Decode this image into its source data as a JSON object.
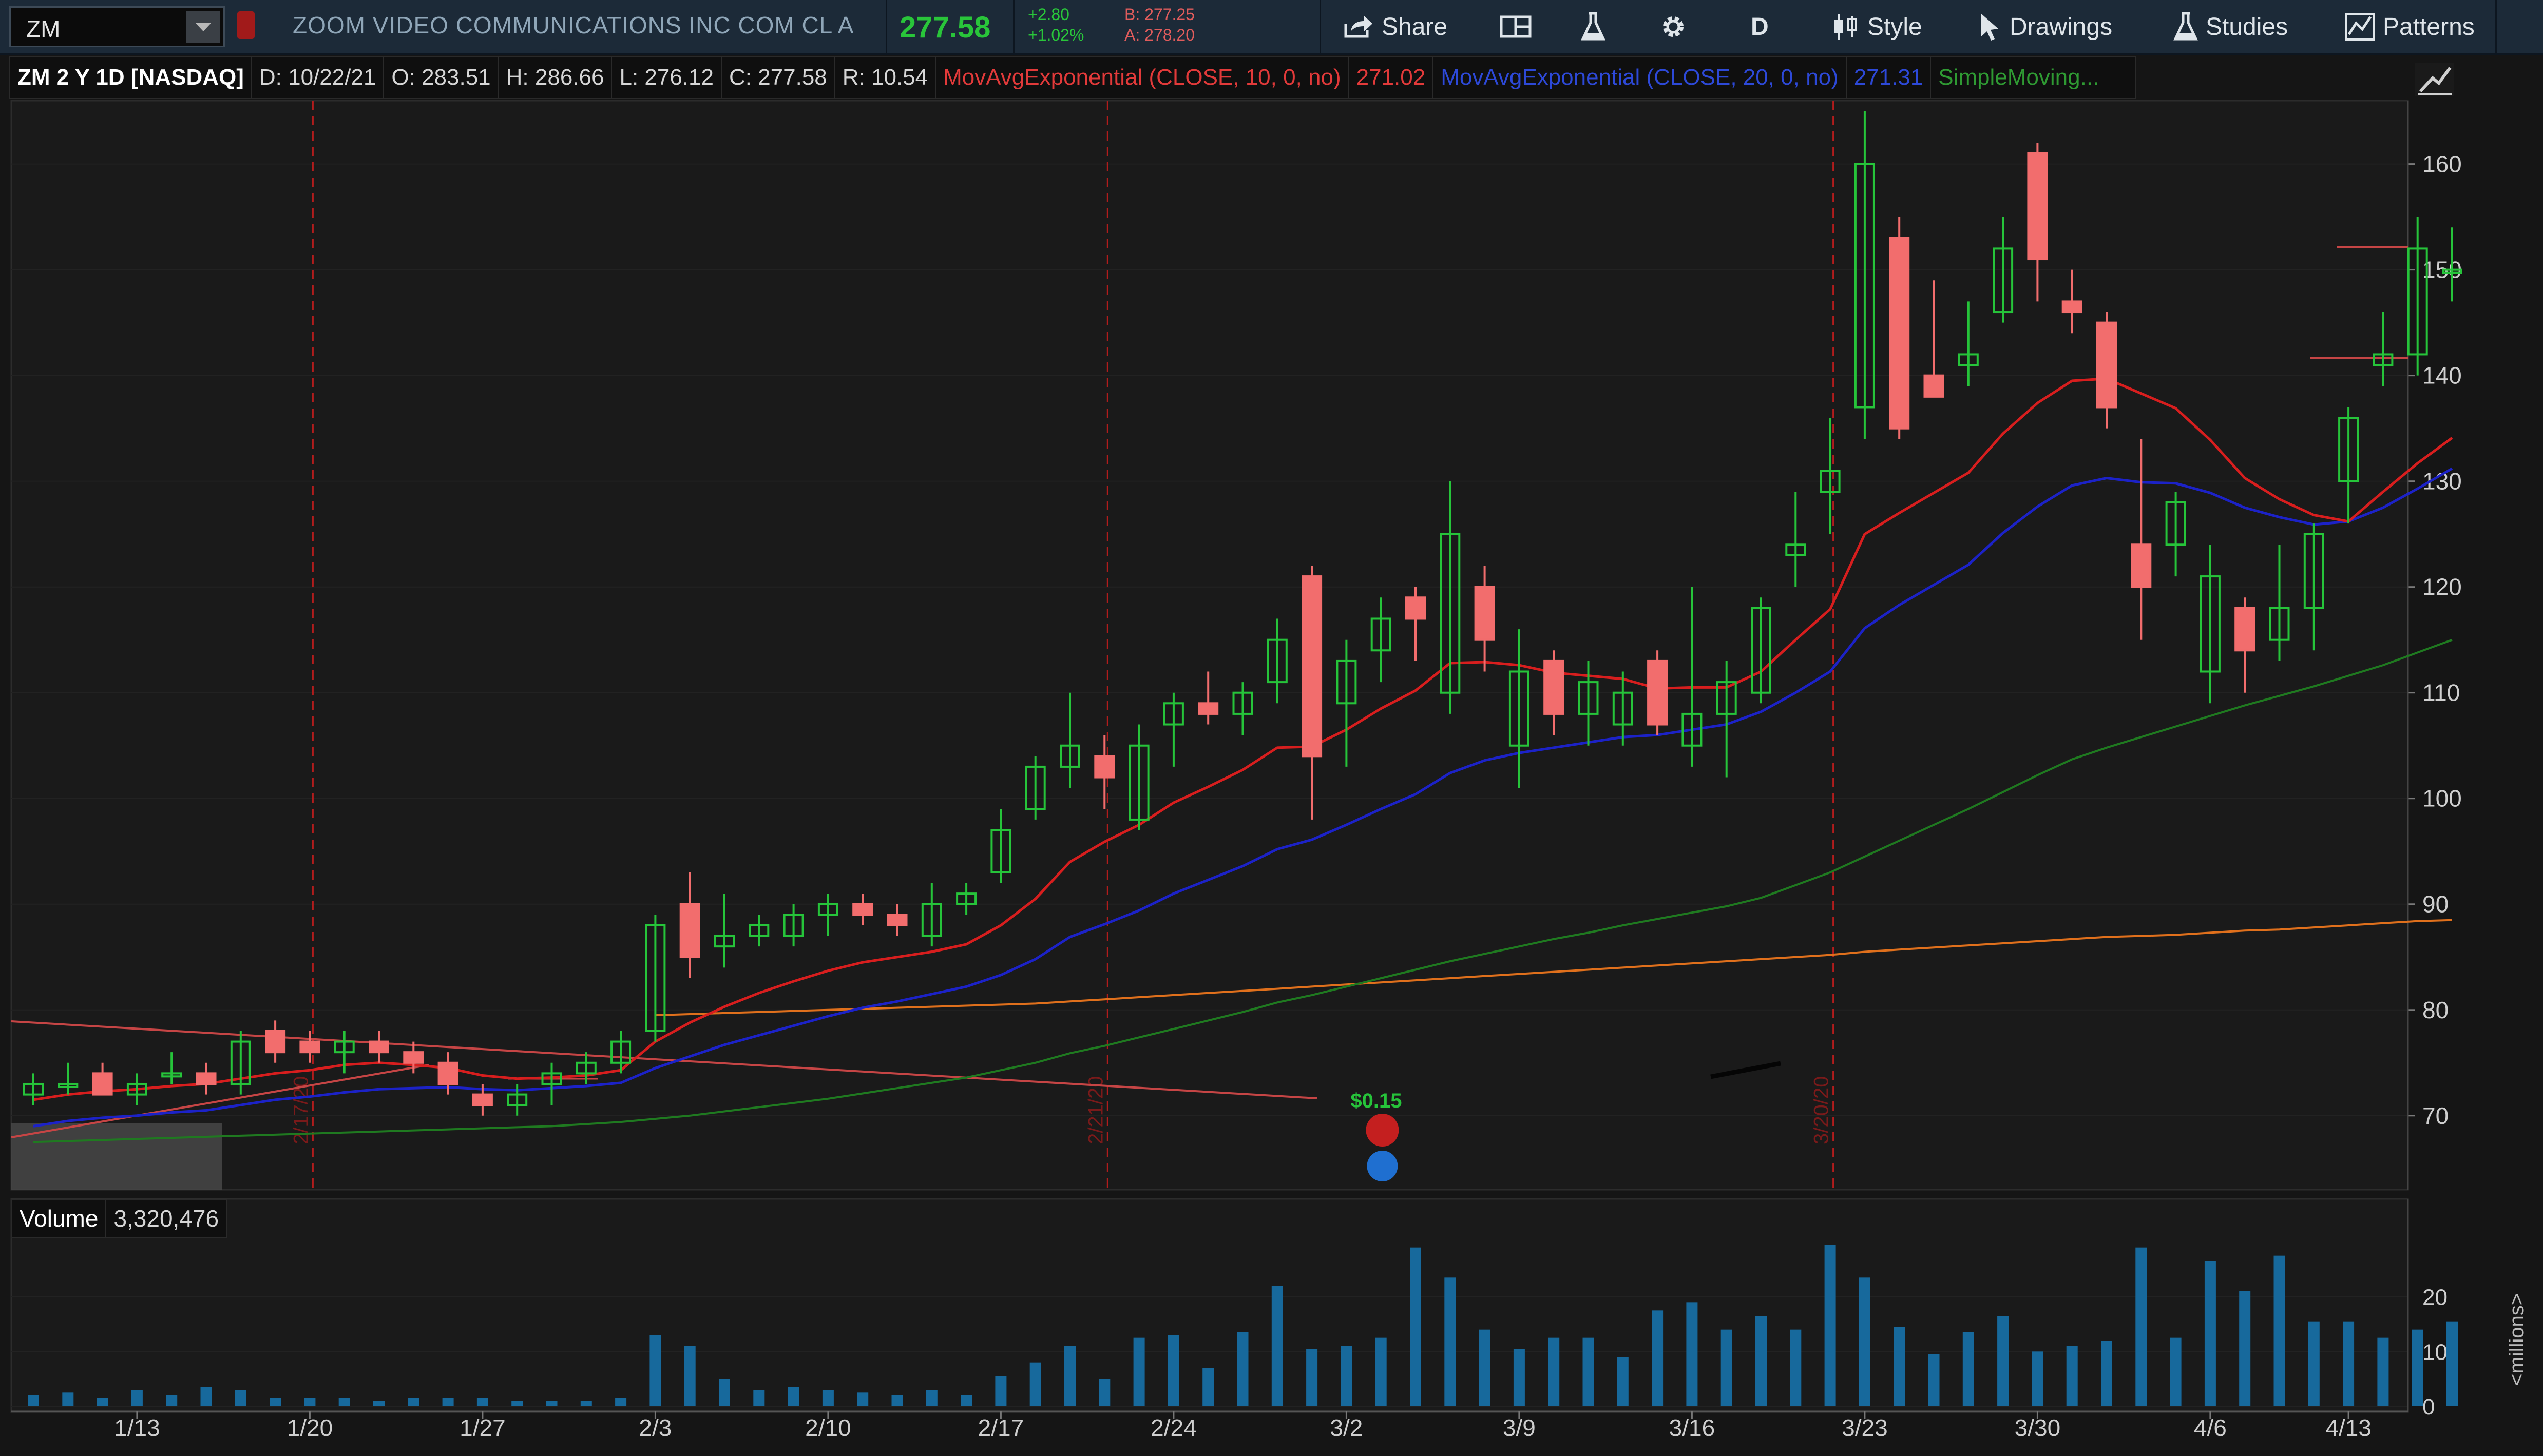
{
  "header": {
    "symbol": "ZM",
    "company": "ZOOM VIDEO COMMUNICATIONS INC COM CL A",
    "last": "277.58",
    "change": "+2.80",
    "change_pct": "+1.02%",
    "bid": "B: 277.25",
    "ask": "A: 278.20",
    "buttons": {
      "share": "Share",
      "period": "D",
      "style": "Style",
      "drawings": "Drawings",
      "studies": "Studies",
      "patterns": "Patterns"
    }
  },
  "info_bar": {
    "title": "ZM 2 Y 1D [NASDAQ]",
    "date": "D: 10/22/21",
    "open": "O: 283.51",
    "high": "H: 286.66",
    "low": "L: 276.12",
    "close": "C: 277.58",
    "range": "R: 10.54",
    "ema10_label": "MovAvgExponential (CLOSE, 10, 0, no)",
    "ema10_value": "271.02",
    "ema20_label": "MovAvgExponential (CLOSE, 20, 0, no)",
    "ema20_value": "271.31",
    "sma_label": "SimpleMoving..."
  },
  "volume_panel": {
    "label": "Volume",
    "value": "3,320,476",
    "unit_label": "<millions>"
  },
  "colors": {
    "up": "#26c43a",
    "down": "#f26d6d",
    "ema10": "#d81e1e",
    "ema20": "#1c22c8",
    "sma_green": "#1f7a20",
    "sma_orange": "#e0701c",
    "volume": "#17699c",
    "marker": "#c41f1f"
  },
  "chart_data": {
    "type": "candlestick",
    "title": "ZM 2 Y 1D [NASDAQ]",
    "ylim": [
      63,
      166
    ],
    "y_ticks": [
      70,
      80,
      90,
      100,
      110,
      120,
      130,
      140,
      150,
      160
    ],
    "x_tick_labels": [
      "1/13",
      "1/20",
      "1/27",
      "2/3",
      "2/10",
      "2/17",
      "2/24",
      "3/2",
      "3/9",
      "3/16",
      "3/23",
      "3/30",
      "4/6",
      "4/13"
    ],
    "x_tick_index": [
      3,
      8,
      13,
      18,
      23,
      28,
      33,
      38,
      43,
      48,
      53,
      58,
      63,
      67
    ],
    "candles": [
      {
        "o": 72,
        "h": 74,
        "l": 71,
        "c": 73
      },
      {
        "o": 73,
        "h": 75,
        "l": 72,
        "c": 73
      },
      {
        "o": 74,
        "h": 75,
        "l": 72,
        "c": 72
      },
      {
        "o": 72,
        "h": 74,
        "l": 71,
        "c": 73
      },
      {
        "o": 74,
        "h": 76,
        "l": 73,
        "c": 74
      },
      {
        "o": 74,
        "h": 75,
        "l": 72,
        "c": 73
      },
      {
        "o": 73,
        "h": 78,
        "l": 72,
        "c": 77
      },
      {
        "o": 78,
        "h": 79,
        "l": 75,
        "c": 76
      },
      {
        "o": 77,
        "h": 78,
        "l": 75,
        "c": 76
      },
      {
        "o": 76,
        "h": 78,
        "l": 74,
        "c": 77
      },
      {
        "o": 77,
        "h": 78,
        "l": 75,
        "c": 76
      },
      {
        "o": 76,
        "h": 77,
        "l": 74,
        "c": 75
      },
      {
        "o": 75,
        "h": 76,
        "l": 72,
        "c": 73
      },
      {
        "o": 72,
        "h": 73,
        "l": 70,
        "c": 71
      },
      {
        "o": 71,
        "h": 73,
        "l": 70,
        "c": 72
      },
      {
        "o": 73,
        "h": 75,
        "l": 71,
        "c": 74
      },
      {
        "o": 74,
        "h": 76,
        "l": 73,
        "c": 75
      },
      {
        "o": 75,
        "h": 78,
        "l": 74,
        "c": 77
      },
      {
        "o": 78,
        "h": 89,
        "l": 77,
        "c": 88
      },
      {
        "o": 90,
        "h": 93,
        "l": 83,
        "c": 85
      },
      {
        "o": 86,
        "h": 91,
        "l": 84,
        "c": 87
      },
      {
        "o": 87,
        "h": 89,
        "l": 86,
        "c": 88
      },
      {
        "o": 87,
        "h": 90,
        "l": 86,
        "c": 89
      },
      {
        "o": 89,
        "h": 91,
        "l": 87,
        "c": 90
      },
      {
        "o": 90,
        "h": 91,
        "l": 88,
        "c": 89
      },
      {
        "o": 89,
        "h": 90,
        "l": 87,
        "c": 88
      },
      {
        "o": 87,
        "h": 92,
        "l": 86,
        "c": 90
      },
      {
        "o": 90,
        "h": 92,
        "l": 89,
        "c": 91
      },
      {
        "o": 93,
        "h": 99,
        "l": 92,
        "c": 97
      },
      {
        "o": 99,
        "h": 104,
        "l": 98,
        "c": 103
      },
      {
        "o": 103,
        "h": 110,
        "l": 101,
        "c": 105
      },
      {
        "o": 104,
        "h": 106,
        "l": 99,
        "c": 102
      },
      {
        "o": 98,
        "h": 107,
        "l": 97,
        "c": 105
      },
      {
        "o": 107,
        "h": 110,
        "l": 103,
        "c": 109
      },
      {
        "o": 109,
        "h": 112,
        "l": 107,
        "c": 108
      },
      {
        "o": 108,
        "h": 111,
        "l": 106,
        "c": 110
      },
      {
        "o": 111,
        "h": 117,
        "l": 109,
        "c": 115
      },
      {
        "o": 121,
        "h": 122,
        "l": 98,
        "c": 104
      },
      {
        "o": 109,
        "h": 115,
        "l": 103,
        "c": 113
      },
      {
        "o": 114,
        "h": 119,
        "l": 111,
        "c": 117
      },
      {
        "o": 119,
        "h": 120,
        "l": 113,
        "c": 117
      },
      {
        "o": 110,
        "h": 130,
        "l": 108,
        "c": 125
      },
      {
        "o": 120,
        "h": 122,
        "l": 112,
        "c": 115
      },
      {
        "o": 105,
        "h": 116,
        "l": 101,
        "c": 112
      },
      {
        "o": 113,
        "h": 114,
        "l": 106,
        "c": 108
      },
      {
        "o": 108,
        "h": 113,
        "l": 105,
        "c": 111
      },
      {
        "o": 107,
        "h": 112,
        "l": 105,
        "c": 110
      },
      {
        "o": 113,
        "h": 114,
        "l": 106,
        "c": 107
      },
      {
        "o": 105,
        "h": 120,
        "l": 103,
        "c": 108
      },
      {
        "o": 108,
        "h": 113,
        "l": 102,
        "c": 111
      },
      {
        "o": 110,
        "h": 119,
        "l": 109,
        "c": 118
      },
      {
        "o": 123,
        "h": 129,
        "l": 120,
        "c": 124
      },
      {
        "o": 129,
        "h": 136,
        "l": 125,
        "c": 131
      },
      {
        "o": 137,
        "h": 165,
        "l": 134,
        "c": 160
      },
      {
        "o": 153,
        "h": 155,
        "l": 134,
        "c": 135
      },
      {
        "o": 140,
        "h": 149,
        "l": 138,
        "c": 138
      },
      {
        "o": 141,
        "h": 147,
        "l": 139,
        "c": 142
      },
      {
        "o": 146,
        "h": 155,
        "l": 145,
        "c": 152
      },
      {
        "o": 161,
        "h": 162,
        "l": 147,
        "c": 151
      },
      {
        "o": 147,
        "h": 150,
        "l": 144,
        "c": 146
      },
      {
        "o": 145,
        "h": 146,
        "l": 135,
        "c": 137
      },
      {
        "o": 124,
        "h": 134,
        "l": 115,
        "c": 120
      },
      {
        "o": 124,
        "h": 129,
        "l": 121,
        "c": 128
      },
      {
        "o": 112,
        "h": 124,
        "l": 109,
        "c": 121
      },
      {
        "o": 118,
        "h": 119,
        "l": 110,
        "c": 114
      },
      {
        "o": 115,
        "h": 124,
        "l": 113,
        "c": 118
      },
      {
        "o": 118,
        "h": 126,
        "l": 114,
        "c": 125
      },
      {
        "o": 130,
        "h": 137,
        "l": 126,
        "c": 136
      },
      {
        "o": 141,
        "h": 146,
        "l": 139,
        "c": 142
      },
      {
        "o": 142,
        "h": 155,
        "l": 140,
        "c": 152
      },
      {
        "o": 150,
        "h": 154,
        "l": 147,
        "c": 150
      }
    ],
    "ema10": [
      71.5,
      72,
      72.3,
      72.5,
      72.8,
      73,
      73.5,
      74,
      74.3,
      74.8,
      75,
      74.8,
      74.5,
      73.8,
      73.5,
      73.6,
      73.8,
      74.3,
      77,
      78.8,
      80.3,
      81.6,
      82.7,
      83.7,
      84.5,
      85,
      85.5,
      86.2,
      88,
      90.5,
      94,
      95.9,
      97.5,
      99.6,
      101.1,
      102.7,
      104.8,
      104.9,
      106.5,
      108.5,
      110.2,
      112.8,
      112.9,
      112.6,
      111.9,
      111.6,
      111.3,
      110.4,
      110.5,
      110.5,
      112,
      115,
      117.9,
      125,
      127,
      128.9,
      130.8,
      134.5,
      137.4,
      139.5,
      139.7,
      138.3,
      136.9,
      133.9,
      130.3,
      128.3,
      126.8,
      126.2,
      129,
      131.7,
      134.1
    ],
    "ema20": [
      69,
      69.5,
      69.8,
      70,
      70.3,
      70.5,
      71,
      71.5,
      71.8,
      72.2,
      72.5,
      72.6,
      72.7,
      72.5,
      72.4,
      72.6,
      72.8,
      73.1,
      74.5,
      75.6,
      76.7,
      77.6,
      78.5,
      79.4,
      80.2,
      80.8,
      81.5,
      82.2,
      83.3,
      84.8,
      86.9,
      88.1,
      89.4,
      91,
      92.3,
      93.6,
      95.2,
      96.1,
      97.5,
      99,
      100.4,
      102.4,
      103.6,
      104.3,
      104.8,
      105.3,
      105.8,
      106,
      106.5,
      107,
      108.2,
      110,
      112,
      116.1,
      118.3,
      120.2,
      122.1,
      125.1,
      127.6,
      129.6,
      130.3,
      129.9,
      129.8,
      128.9,
      127.5,
      126.6,
      125.9,
      126.2,
      127.5,
      129.3,
      131.2
    ],
    "sma50": [
      67.5,
      67.6,
      67.7,
      67.8,
      67.9,
      68,
      68.1,
      68.2,
      68.3,
      68.4,
      68.5,
      68.6,
      68.7,
      68.8,
      68.9,
      69,
      69.2,
      69.4,
      69.7,
      70,
      70.4,
      70.8,
      71.2,
      71.6,
      72.1,
      72.6,
      73.1,
      73.6,
      74.3,
      75,
      75.9,
      76.6,
      77.4,
      78.2,
      79,
      79.8,
      80.7,
      81.4,
      82.2,
      83,
      83.8,
      84.6,
      85.3,
      86,
      86.7,
      87.3,
      88,
      88.6,
      89.2,
      89.8,
      90.6,
      91.8,
      93,
      94.5,
      96,
      97.5,
      99,
      100.6,
      102.2,
      103.7,
      104.8,
      105.8,
      106.8,
      107.8,
      108.8,
      109.7,
      110.6,
      111.6,
      112.6,
      113.8,
      115
    ],
    "sma200": [
      null,
      null,
      null,
      null,
      null,
      null,
      null,
      null,
      null,
      null,
      null,
      null,
      null,
      null,
      null,
      null,
      null,
      null,
      79.5,
      79.6,
      79.7,
      79.8,
      79.9,
      80,
      80.1,
      80.2,
      80.3,
      80.4,
      80.5,
      80.6,
      80.8,
      81,
      81.2,
      81.4,
      81.6,
      81.8,
      82,
      82.2,
      82.4,
      82.6,
      82.8,
      83,
      83.2,
      83.4,
      83.6,
      83.8,
      84,
      84.2,
      84.4,
      84.6,
      84.8,
      85,
      85.2,
      85.5,
      85.7,
      85.9,
      86.1,
      86.3,
      86.5,
      86.7,
      86.9,
      87,
      87.1,
      87.3,
      87.5,
      87.6,
      87.8,
      88,
      88.2,
      88.4,
      88.5
    ],
    "volume_millions": [
      2,
      2.5,
      1.5,
      3,
      2,
      3.5,
      3,
      1.5,
      1.5,
      1.5,
      1,
      1.5,
      1.5,
      1.5,
      1,
      1,
      1,
      1.5,
      13,
      11,
      5,
      3,
      3.5,
      3,
      2.5,
      2,
      3,
      2,
      5.5,
      8,
      11,
      5,
      12.5,
      13,
      7,
      13.5,
      22,
      10.5,
      11,
      12.5,
      29,
      23.5,
      14,
      10.5,
      12.5,
      12.5,
      9,
      17.5,
      19,
      14,
      16.5,
      14,
      29.5,
      23.5,
      14.5,
      9.5,
      13.5,
      16.5,
      10,
      11,
      12,
      29,
      12.5,
      26.5,
      21,
      27.5,
      15.5,
      15.5,
      12.5,
      14,
      15.5
    ],
    "volume_ylim": [
      0,
      30
    ],
    "volume_ticks": [
      0,
      10,
      20
    ],
    "annotations": {
      "event_lines_index": [
        8,
        31,
        52
      ],
      "event_line_labels": [
        "2/17/20",
        "2/21/20",
        "3/20/20"
      ],
      "dividend_label": "$0.15",
      "dividend_index": 38
    }
  }
}
